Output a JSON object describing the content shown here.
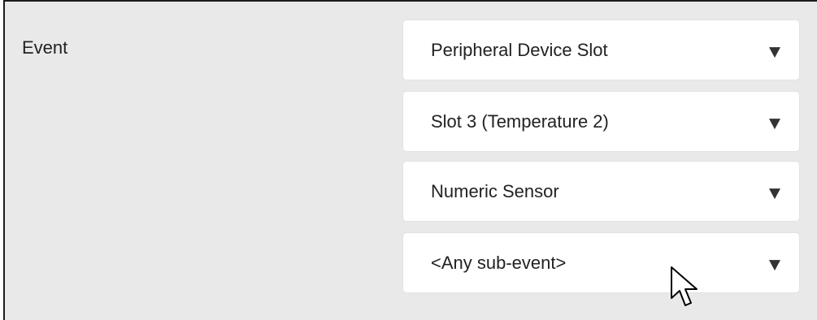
{
  "event_label": "Event",
  "selects": [
    {
      "value": "Peripheral Device Slot",
      "icon": "chevron-down-icon"
    },
    {
      "value": "Slot 3 (Temperature 2)",
      "icon": "chevron-down-icon"
    },
    {
      "value": "Numeric Sensor",
      "icon": "chevron-down-icon"
    },
    {
      "value": "<Any sub-event>",
      "icon": "chevron-down-icon"
    }
  ],
  "cursor_icon": "mouse-pointer-icon",
  "colors": {
    "panel_background": "#e9e9e9",
    "select_background": "#ffffff",
    "text": "#222222",
    "border": "#1c1c1c"
  }
}
